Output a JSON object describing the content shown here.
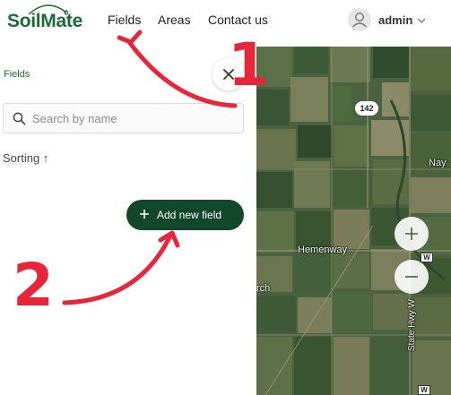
{
  "brand": {
    "name": "SoilMate",
    "color": "#1b6b3a"
  },
  "nav": {
    "fields": "Fields",
    "areas": "Areas",
    "contact": "Contact us"
  },
  "user": {
    "name": "admin",
    "avatar_icon": "user-icon"
  },
  "sidebar": {
    "breadcrumb": "Fields",
    "search_placeholder": "Search by name",
    "search_value": "",
    "sorting_label": "Sorting ↑",
    "add_button_label": "Add new field"
  },
  "map": {
    "route_shield": "142",
    "place_labels": [
      "Hemenway",
      "Nay",
      "rch"
    ],
    "road_label": "State Hwy W",
    "road_markers": [
      "W",
      "W"
    ],
    "zoom_in_label": "+",
    "zoom_out_label": "−"
  },
  "annotations": {
    "step_1": "1",
    "step_2": "2",
    "color": "#e8263a"
  },
  "colors": {
    "primary_button": "#11472a",
    "accent_red": "#e8263a"
  }
}
